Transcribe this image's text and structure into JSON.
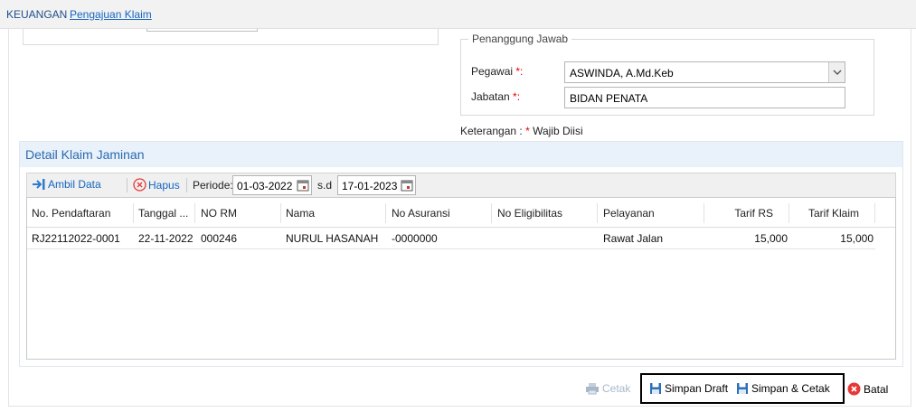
{
  "breadcrumb": {
    "root": "KEUANGAN",
    "page": "Pengajuan Klaim"
  },
  "penanggung_jawab": {
    "legend": "Penanggung Jawab",
    "pegawai_label": "Pegawai",
    "pegawai_value": "ASWINDA, A.Md.Keb",
    "jabatan_label": "Jabatan",
    "jabatan_value": "BIDAN PENATA",
    "required_mark": "*:"
  },
  "keterangan": {
    "prefix": "Keterangan : ",
    "mark": "*",
    "text": " Wajib Diisi"
  },
  "detail": {
    "title": "Detail Klaim Jaminan",
    "toolbar": {
      "ambil_label": "Ambil Data",
      "hapus_label": "Hapus",
      "periode_label": "Periode:",
      "date_from": "01-03-2022",
      "sd_label": "s.d",
      "date_to": "17-01-2023"
    },
    "columns": [
      "No. Pendaftaran",
      "Tanggal ...",
      "NO RM",
      "Nama",
      "No Asuransi",
      "No Eligibilitas",
      "Pelayanan",
      "Tarif RS",
      "Tarif Klaim"
    ],
    "rows": [
      [
        "RJ22112022-0001",
        "22-11-2022",
        "000246",
        "NURUL HASANAH",
        "-0000000",
        "",
        "Rawat Jalan",
        "15,000",
        "15,000"
      ]
    ]
  },
  "footer": {
    "cetak_label": "Cetak",
    "simpan_draft_label": "Simpan Draft",
    "simpan_cetak_label": "Simpan & Cetak",
    "batal_label": "Batal"
  },
  "colors": {
    "link": "#1565c0",
    "required": "#e00000",
    "panel_header": "#e9f1fb",
    "danger": "#e53935"
  }
}
